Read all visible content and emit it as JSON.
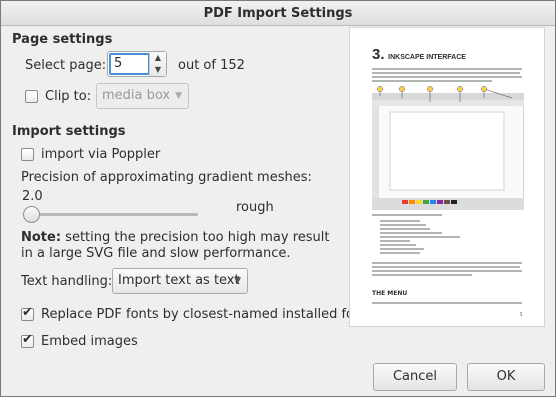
{
  "window": {
    "title": "PDF Import Settings"
  },
  "page_settings": {
    "heading": "Page settings",
    "select_page_label": "Select page:",
    "page_value": "5",
    "out_of_text": "out of 152",
    "clip_to_label": "Clip to:",
    "clip_to_checked": false,
    "clip_to_value": "media box"
  },
  "import_settings": {
    "heading": "Import settings",
    "poppler_label": "import via Poppler",
    "poppler_checked": false,
    "precision_label": "Precision of approximating gradient meshes:",
    "precision_value": "2.0",
    "precision_quality": "rough",
    "note_bold": "Note:",
    "note_text": " setting the precision too high may result in a large SVG file and slow performance.",
    "text_handling_label": "Text handling:",
    "text_handling_value": "Import text as text",
    "replace_fonts_label": "Replace PDF fonts by closest-named installed fonts",
    "replace_fonts_checked": true,
    "embed_images_label": "Embed images",
    "embed_images_checked": true
  },
  "preview": {
    "heading_num": "3.",
    "heading_text": "INKSCAPE INTERFACE",
    "menu_heading": "THE MENU",
    "page_num": "5"
  },
  "buttons": {
    "cancel": "Cancel",
    "ok": "OK"
  }
}
